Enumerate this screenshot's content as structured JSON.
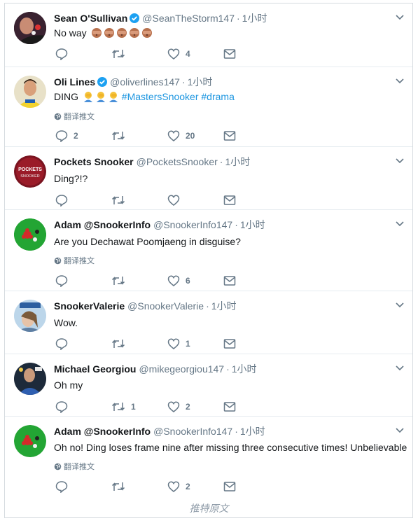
{
  "tweets": [
    {
      "name": "Sean O'Sullivan",
      "verified": true,
      "handle": "@SeanTheStorm147",
      "time": "1小时",
      "text": "No way",
      "emoji_count": 5,
      "emoji": "see-no-evil-monkey-emoji",
      "translate": "",
      "replies": "",
      "retweets": "",
      "likes": "4"
    },
    {
      "name": "Oli Lines",
      "verified": true,
      "handle": "@oliverlines147",
      "time": "1小时",
      "text": "DING",
      "emoji_count": 3,
      "emoji": "facepalm-emoji",
      "hashtags": "#MastersSnooker #drama",
      "translate": "翻译推文",
      "replies": "2",
      "retweets": "",
      "likes": "20"
    },
    {
      "name": "Pockets Snooker",
      "verified": false,
      "handle": "@PocketsSnooker",
      "time": "1小时",
      "text": "Ding?!?",
      "translate": "",
      "replies": "",
      "retweets": "",
      "likes": ""
    },
    {
      "name": "Adam @SnookerInfo",
      "verified": false,
      "handle": "@SnookerInfo147",
      "time": "1小时",
      "text": "Are you Dechawat Poomjaeng in disguise?",
      "translate": "翻译推文",
      "replies": "",
      "retweets": "",
      "likes": "6"
    },
    {
      "name": "SnookerValerie",
      "verified": false,
      "handle": "@SnookerValerie",
      "time": "1小时",
      "text": "Wow.",
      "translate": "",
      "replies": "",
      "retweets": "",
      "likes": "1"
    },
    {
      "name": "Michael Georgiou",
      "verified": false,
      "handle": "@mikegeorgiou147",
      "time": "1小时",
      "text": "Oh my",
      "translate": "",
      "replies": "",
      "retweets": "1",
      "likes": "2"
    },
    {
      "name": "Adam @SnookerInfo",
      "verified": false,
      "handle": "@SnookerInfo147",
      "time": "1小时",
      "text": "Oh no! Ding loses frame nine after missing three consecutive times! Unbelievable",
      "translate": "翻译推文",
      "replies": "",
      "retweets": "",
      "likes": "2"
    }
  ],
  "avatar_labels": {
    "pockets": "POCKETS",
    "snooker": "SNOOKER"
  },
  "footer": "推特原文",
  "colors": {
    "link": "#1b95e0",
    "muted": "#657786",
    "divider": "#e6ecf0",
    "verified": "#1da1f2",
    "snooker_green": "#1e9b2e"
  }
}
